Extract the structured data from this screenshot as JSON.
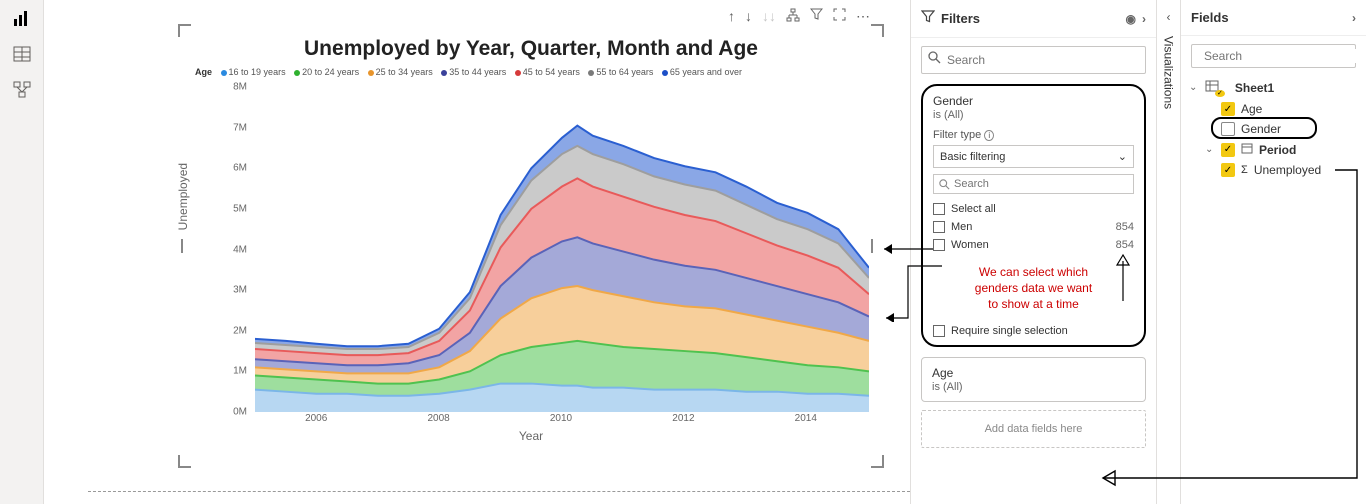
{
  "leftbar": {
    "items": [
      "report",
      "data",
      "model"
    ]
  },
  "viz_actions": [
    "↑",
    "↓",
    "⇊",
    "⛶",
    "▽",
    "⇱",
    "⋯"
  ],
  "chart_data": {
    "type": "area",
    "title": "Unemployed by Year, Quarter, Month and Age",
    "xlabel": "Year",
    "ylabel": "Unemployed",
    "legend_title": "Age",
    "ylim": [
      0,
      8
    ],
    "yticks": [
      "0M",
      "1M",
      "2M",
      "3M",
      "4M",
      "5M",
      "6M",
      "7M",
      "8M"
    ],
    "xticks": [
      "2006",
      "2008",
      "2010",
      "2012",
      "2014"
    ],
    "x_range": [
      2005,
      2015
    ],
    "series": [
      {
        "name": "16 to 19 years",
        "color": "#7bb6e8"
      },
      {
        "name": "20 to 24 years",
        "color": "#4fc24f"
      },
      {
        "name": "25 to 34 years",
        "color": "#f0a848"
      },
      {
        "name": "35 to 44 years",
        "color": "#5a63b8"
      },
      {
        "name": "45 to 54 years",
        "color": "#e85a5a"
      },
      {
        "name": "55 to 64 years",
        "color": "#9e9e9e"
      },
      {
        "name": "65 years and over",
        "color": "#2a5fd1"
      }
    ],
    "samples_note": "stacked totals in millions, approximated from chart pixels",
    "x": [
      2005,
      2005.5,
      2006,
      2006.5,
      2007,
      2007.5,
      2008,
      2008.5,
      2009,
      2009.5,
      2010,
      2010.25,
      2010.5,
      2011,
      2011.5,
      2012,
      2012.5,
      2013,
      2013.5,
      2014,
      2014.5,
      2015
    ],
    "stack_top": {
      "16 to 19 years": [
        0.55,
        0.5,
        0.45,
        0.45,
        0.4,
        0.4,
        0.45,
        0.55,
        0.7,
        0.7,
        0.65,
        0.65,
        0.6,
        0.6,
        0.55,
        0.55,
        0.55,
        0.5,
        0.5,
        0.45,
        0.45,
        0.4
      ],
      "20 to 24 years": [
        0.9,
        0.85,
        0.8,
        0.75,
        0.7,
        0.7,
        0.8,
        1.0,
        1.4,
        1.6,
        1.7,
        1.75,
        1.7,
        1.6,
        1.55,
        1.5,
        1.45,
        1.35,
        1.25,
        1.15,
        1.1,
        1.0
      ],
      "25 to 34 years": [
        1.1,
        1.05,
        1.0,
        0.95,
        0.95,
        0.95,
        1.1,
        1.5,
        2.3,
        2.8,
        3.05,
        3.1,
        3.0,
        2.85,
        2.7,
        2.6,
        2.55,
        2.4,
        2.25,
        2.1,
        1.95,
        1.75
      ],
      "35 to 44 years": [
        1.3,
        1.25,
        1.2,
        1.15,
        1.15,
        1.2,
        1.4,
        1.95,
        3.1,
        3.8,
        4.2,
        4.3,
        4.15,
        3.95,
        3.75,
        3.6,
        3.5,
        3.3,
        3.1,
        2.9,
        2.7,
        2.35
      ],
      "45 to 54 years": [
        1.55,
        1.5,
        1.45,
        1.4,
        1.4,
        1.45,
        1.75,
        2.5,
        4.05,
        5.0,
        5.55,
        5.75,
        5.55,
        5.3,
        5.05,
        4.85,
        4.7,
        4.4,
        4.1,
        3.85,
        3.55,
        2.9
      ],
      "55 to 64 years": [
        1.7,
        1.65,
        1.6,
        1.55,
        1.55,
        1.6,
        1.95,
        2.8,
        4.6,
        5.7,
        6.35,
        6.55,
        6.35,
        6.1,
        5.8,
        5.6,
        5.45,
        5.1,
        4.75,
        4.5,
        4.15,
        3.3
      ],
      "65 years and over": [
        1.8,
        1.75,
        1.68,
        1.62,
        1.62,
        1.68,
        2.05,
        2.95,
        4.85,
        6.0,
        6.75,
        7.05,
        6.8,
        6.55,
        6.25,
        6.05,
        5.9,
        5.55,
        5.15,
        4.9,
        4.5,
        3.55
      ]
    }
  },
  "filters": {
    "title": "Filters",
    "search_ph": "Search",
    "gender_card": {
      "title": "Gender",
      "sub": "is (All)",
      "filter_type_label": "Filter type",
      "filter_type_value": "Basic filtering",
      "search_ph": "Search",
      "options": [
        {
          "label": "Select all",
          "count": ""
        },
        {
          "label": "Men",
          "count": "854"
        },
        {
          "label": "Women",
          "count": "854"
        }
      ],
      "note_l1": "We can select which",
      "note_l2": "genders data we want",
      "note_l3": "to show at a time",
      "require": "Require single selection"
    },
    "age_card": {
      "title": "Age",
      "sub": "is (All)"
    },
    "add_hint": "Add data fields here"
  },
  "viz_rail": {
    "label": "Visualizations"
  },
  "fields": {
    "title": "Fields",
    "search_ph": "Search",
    "table": "Sheet1",
    "items": [
      {
        "label": "Age",
        "checked": true,
        "icon": ""
      },
      {
        "label": "Gender",
        "checked": false,
        "icon": ""
      },
      {
        "label": "Period",
        "checked": true,
        "icon": "calendar",
        "expandable": true
      },
      {
        "label": "Unemployed",
        "checked": true,
        "icon": "sigma"
      }
    ]
  }
}
